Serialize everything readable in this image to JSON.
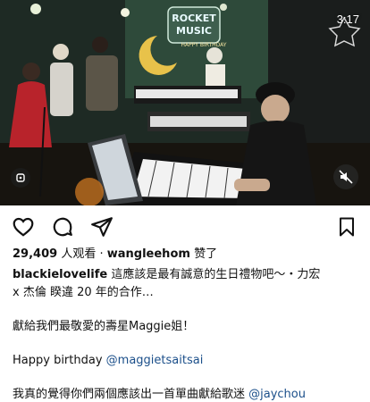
{
  "video": {
    "timestamp": "3:17",
    "sign_text_line1": "ROCKET",
    "sign_text_line2": "MUSIC",
    "banner_text": "HAPPY BIRTHDAY",
    "icons": {
      "sticker": "sticker-icon",
      "mute": "speaker-muted-icon"
    }
  },
  "actions": {
    "icons": [
      "heart-icon",
      "comment-icon",
      "share-icon",
      "bookmark-icon"
    ]
  },
  "meta": {
    "views": "29,409",
    "views_label": "人观看",
    "separator": "·",
    "liker": "wangleehom",
    "liked_suffix": "赞了"
  },
  "caption": {
    "username": "blackielovelife",
    "line1_text": "這應該是最有誠意的生日禮物吧～・力宏",
    "line2_text": "x 杰倫 睽違 20 年的合作…",
    "line3_text": "獻給我們最敬愛的壽星Maggie姐！",
    "line4_prefix": "Happy birthday ",
    "line4_mention": "@maggietsaitsai",
    "line5_prefix": "我真的覺得你們兩個應該出一首單曲獻給歌迷 ",
    "line5_mention": "@jaychou"
  }
}
